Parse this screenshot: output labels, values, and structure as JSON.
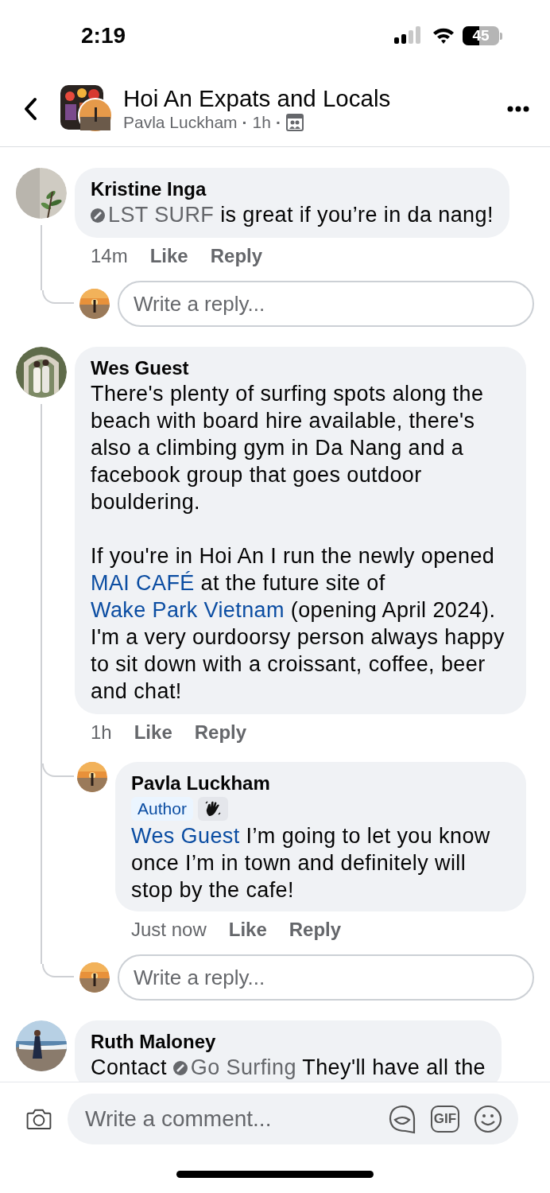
{
  "status_bar": {
    "time": "2:19",
    "battery": "45"
  },
  "header": {
    "title": "Hoi An Expats and Locals",
    "author": "Pavla Luckham",
    "separator": "·",
    "time": "1h"
  },
  "comments": [
    {
      "author": "Kristine Inga",
      "paragraphs": [
        [
          {
            "kind": "page",
            "text": "LST SURF"
          },
          {
            "kind": "text",
            "text": " is great if you’re in da nang!"
          }
        ]
      ],
      "time": "14m",
      "actions": [
        "Like",
        "Reply"
      ],
      "reply_box": {
        "placeholder": "Write a reply..."
      }
    },
    {
      "author": "Wes Guest",
      "paragraphs": [
        [
          {
            "kind": "text",
            "text": "There's plenty of surfing spots along the beach with board hire available, there's also a climbing gym in Da Nang and a facebook group that goes outdoor bouldering."
          }
        ],
        [
          {
            "kind": "text",
            "text": "If you're in Hoi An I run the newly opened "
          },
          {
            "kind": "link",
            "text": "MAI CAFÉ"
          },
          {
            "kind": "text",
            "text": " at the future site of "
          },
          {
            "kind": "link",
            "text": "Wake Park Vietnam"
          },
          {
            "kind": "text",
            "text": " (opening April 2024). I'm a very ourdoorsy person always happy to sit down with a croissant, coffee, beer and chat!"
          }
        ]
      ],
      "time": "1h",
      "actions": [
        "Like",
        "Reply"
      ],
      "replies": [
        {
          "author": "Pavla Luckham",
          "badges": [
            {
              "kind": "author",
              "text": "Author"
            },
            {
              "kind": "wave"
            }
          ],
          "paragraphs": [
            [
              {
                "kind": "person",
                "text": "Wes Guest"
              },
              {
                "kind": "text",
                "text": " I’m going to let you know once I’m in town and definitely will stop by the cafe!"
              }
            ]
          ],
          "time": "Just now",
          "actions": [
            "Like",
            "Reply"
          ]
        }
      ],
      "reply_box": {
        "placeholder": "Write a reply..."
      }
    },
    {
      "author": "Ruth Maloney",
      "paragraphs": [
        [
          {
            "kind": "text",
            "text": "Contact "
          },
          {
            "kind": "page",
            "text": "Go Surfing"
          },
          {
            "kind": "text",
            "text": "  They'll have all the"
          }
        ]
      ]
    }
  ],
  "composer": {
    "placeholder": "Write a comment...",
    "gif": "GIF"
  }
}
